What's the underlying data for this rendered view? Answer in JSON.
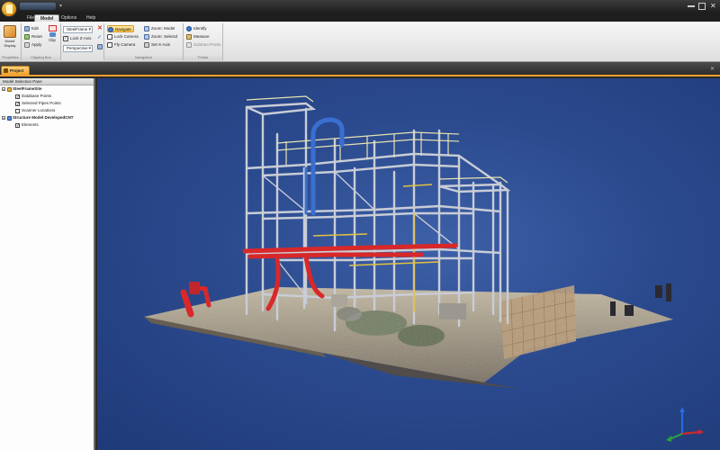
{
  "ribbon_tabs": {
    "file": "File",
    "model": "Model",
    "options": "Options",
    "help": "Help"
  },
  "ribbon": {
    "model_display": "Model Display",
    "properties_label": "Properties",
    "edit": "Edit",
    "reset": "Reset",
    "apply": "Apply",
    "clip": "Clip",
    "clipping_box_label": "Clipping Box",
    "display_combo": "SteelFrame",
    "lock_z_axis": "Lock Z-Axis",
    "projection_combo": "Perspective",
    "navigate": "Navigate",
    "lock_camera": "Lock Camera",
    "fly_camera": "Fly Camera",
    "zoom_model": "Zoom: Model",
    "zoom_selected": "Zoom: Selectd",
    "set_x_axis": "Set X-Axis",
    "navigation_label": "Navigation",
    "identify": "Identify",
    "measure": "Measure",
    "subtract_points": "Subtract Points",
    "points_label": "Points"
  },
  "project_tab": "Project",
  "tree": {
    "title": "Model Selection Pane",
    "root1": "SteelFrameSite",
    "item_database_points": "Database Points",
    "item_selected_points": "Selected Pipes Points",
    "item_scanner_locations": "Scanner Locations",
    "root2": "Structure Model DevelopedCNT",
    "item_elements": "Elements"
  },
  "colors": {
    "viewport_bg": "#2b4a8e",
    "accent": "#f0a030",
    "steel": "#c8ccd4",
    "pipe_red": "#d8282a",
    "pipe_blue": "#3a6fd0",
    "rail_yellow": "#e2c040"
  },
  "icons": {
    "app": "app-menu-icon",
    "axis": "xyz-axis-triad-icon"
  }
}
